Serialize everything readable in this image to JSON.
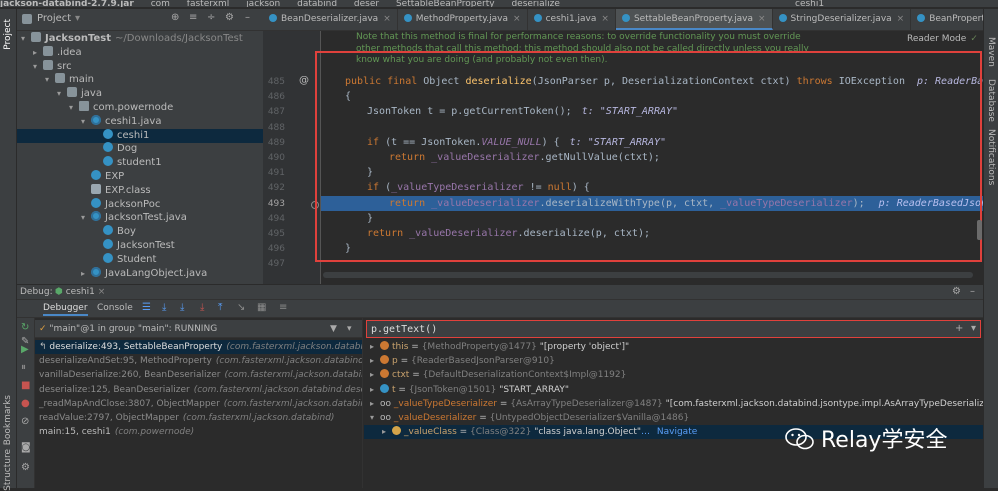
{
  "titlebar": {
    "items": [
      "jackson-databind-2.7.9.jar",
      "com",
      "fasterxml",
      "jackson",
      "databind",
      "deser",
      "SettableBeanProperty",
      "deserialize"
    ],
    "run_config": "ceshi1"
  },
  "left_strip": {
    "project": "Project",
    "bookmarks": "Bookmarks",
    "structure": "Structure"
  },
  "right_strip": {
    "maven": "Maven",
    "database": "Database",
    "notifications": "Notifications"
  },
  "project_panel": {
    "title": "Project"
  },
  "tree": [
    {
      "label": "JacksonTest",
      "extra": "~/Downloads/JacksonTest",
      "icon": "folder",
      "depth": 0,
      "arrow": "▾"
    },
    {
      "label": ".idea",
      "icon": "folder",
      "depth": 1,
      "arrow": "▸"
    },
    {
      "label": "src",
      "icon": "folder",
      "depth": 1,
      "arrow": "▾"
    },
    {
      "label": "main",
      "icon": "folder",
      "depth": 2,
      "arrow": "▾"
    },
    {
      "label": "java",
      "icon": "folder",
      "depth": 3,
      "arrow": "▾"
    },
    {
      "label": "com.powernode",
      "icon": "pkg",
      "depth": 4,
      "arrow": "▾"
    },
    {
      "label": "ceshi1.java",
      "icon": "java",
      "depth": 5,
      "arrow": "▾"
    },
    {
      "label": "ceshi1",
      "icon": "cls",
      "depth": 6,
      "arrow": "",
      "selected": true
    },
    {
      "label": "Dog",
      "icon": "cls",
      "depth": 6,
      "arrow": ""
    },
    {
      "label": "student1",
      "icon": "cls",
      "depth": 6,
      "arrow": ""
    },
    {
      "label": "EXP",
      "icon": "cls",
      "depth": 5,
      "arrow": ""
    },
    {
      "label": "EXP.class",
      "icon": "file",
      "depth": 5,
      "arrow": ""
    },
    {
      "label": "JacksonPoc",
      "icon": "cls",
      "depth": 5,
      "arrow": ""
    },
    {
      "label": "JacksonTest.java",
      "icon": "java",
      "depth": 5,
      "arrow": "▾"
    },
    {
      "label": "Boy",
      "icon": "cls",
      "depth": 6,
      "arrow": ""
    },
    {
      "label": "JacksonTest",
      "icon": "cls",
      "depth": 6,
      "arrow": ""
    },
    {
      "label": "Student",
      "icon": "cls",
      "depth": 6,
      "arrow": ""
    },
    {
      "label": "JavaLangObject.java",
      "icon": "java",
      "depth": 5,
      "arrow": "▸"
    }
  ],
  "tabs": [
    {
      "label": "BeanDeserializer.java",
      "active": false
    },
    {
      "label": "MethodProperty.java",
      "active": false
    },
    {
      "label": "ceshi1.java",
      "active": false
    },
    {
      "label": "SettableBeanProperty.java",
      "active": true
    },
    {
      "label": "StringDeserializer.java",
      "active": false
    },
    {
      "label": "BeanPropertyMap.java",
      "active": false
    }
  ],
  "reader_mode": "Reader Mode",
  "doc_comment": [
    "Note that this method is final for performance reasons: to override functionality you must override",
    "other methods that call this method; this method should also not be called directly unless you really",
    "know what you are doing (and probably not even then)."
  ],
  "line_numbers": [
    "485",
    "486",
    "487",
    "488",
    "489",
    "490",
    "491",
    "492",
    "493",
    "494",
    "495",
    "496",
    "497"
  ],
  "code": {
    "l485": {
      "kw1": "public final ",
      "type": "Object ",
      "fn": "deserialize",
      "rest": "(JsonParser p, DeserializationContext ctxt) ",
      "kw2": "throws ",
      "exc": "IOException",
      "hint": "p: ReaderBasedJsonPa"
    },
    "l487": {
      "text": "JsonToken t = p.getCurrentToken();",
      "hint": "t: \"START_ARRAY\""
    },
    "l489": {
      "kw": "if ",
      "pre": "(t == JsonToken.",
      "fld": "VALUE_NULL",
      "post": ") {",
      "hint": "t: \"START_ARRAY\""
    },
    "l490": {
      "kw": "return ",
      "fld": "_valueDeserializer",
      "post": ".getNullValue(ctxt);"
    },
    "l491": {
      "text": "}"
    },
    "l492": {
      "kw": "if ",
      "pre": "(",
      "fld": "_valueTypeDeserializer",
      "mid": " != ",
      "kw2": "null",
      "post": ") {"
    },
    "l493": {
      "kw": "return ",
      "fld": "_valueDeserializer",
      "mid": ".deserializeWithType(p, ctxt, ",
      "fld2": "_valueTypeDeserializer",
      "post": ");",
      "hint": "p: ReaderBasedJsonParser@9"
    },
    "l494": {
      "text": "}"
    },
    "l495": {
      "kw": "return ",
      "fld": "_valueDeserializer",
      "post": ".deserialize(p, ctxt);"
    },
    "l496": {
      "text": "}"
    }
  },
  "debug": {
    "label": "Debug:",
    "session": "ceshi1",
    "tab_debugger": "Debugger",
    "tab_console": "Console",
    "thread": "\"main\"@1 in group \"main\": RUNNING",
    "expression": "p.getText()"
  },
  "frames": [
    {
      "method": "deserialize:493, SettableBeanProperty",
      "pkg": "(com.fasterxml.jackson.databind.d",
      "selected": true
    },
    {
      "method": "deserializeAndSet:95, MethodProperty",
      "pkg": "(com.fasterxml.jackson.databind.d",
      "selected": false
    },
    {
      "method": "vanillaDeserialize:260, BeanDeserializer",
      "pkg": "(com.fasterxml.jackson.databind.d",
      "selected": false
    },
    {
      "method": "deserialize:125, BeanDeserializer",
      "pkg": "(com.fasterxml.jackson.databind.deser)",
      "selected": false
    },
    {
      "method": "_readMapAndClose:3807, ObjectMapper",
      "pkg": "(com.fasterxml.jackson.databind)",
      "selected": false
    },
    {
      "method": "readValue:2797, ObjectMapper",
      "pkg": "(com.fasterxml.jackson.databind)",
      "selected": false
    },
    {
      "method": "main:15, ceshi1",
      "pkg": "(com.powernode)",
      "selected": false
    }
  ],
  "variables": [
    {
      "arrow": "▸",
      "badge": "#cc7832",
      "name": "this",
      "eq": " = ",
      "type": "{MethodProperty@1477} ",
      "val": "\"[property 'object']\"",
      "link": "",
      "indent": 0
    },
    {
      "arrow": "▸",
      "badge": "#cc7832",
      "name": "p",
      "eq": " = ",
      "type": "{ReaderBasedJsonParser@910}",
      "val": "",
      "link": "",
      "indent": 0
    },
    {
      "arrow": "▸",
      "badge": "#cc7832",
      "name": "ctxt",
      "eq": " = ",
      "type": "{DefaultDeserializationContext$Impl@1192}",
      "val": "",
      "link": "",
      "indent": 0
    },
    {
      "arrow": "▸",
      "badge": "#3592c4",
      "name": "t",
      "eq": " = ",
      "type": "{JsonToken@1501} ",
      "val": "\"START_ARRAY\"",
      "link": "",
      "indent": 0
    },
    {
      "arrow": "▸",
      "badge": "oo",
      "name": "_valueTypeDeserializer",
      "eq": " = ",
      "type": "{AsArrayTypeDeserializer@1487} ",
      "val": "\"[com.fasterxml.jackson.databind.jsontype.impl.AsArrayTypeDeserializer; b",
      "link": "View",
      "indent": 0
    },
    {
      "arrow": "▾",
      "badge": "oo",
      "name": "_valueDeserializer",
      "eq": " = ",
      "type": "{UntypedObjectDeserializer$Vanilla@1486}",
      "val": "",
      "link": "",
      "indent": 0
    },
    {
      "arrow": "▸",
      "badge": "#d4a44a",
      "name": "_valueClass",
      "eq": " = ",
      "type": "{Class@322} ",
      "val": "\"class java.lang.Object\"",
      "link": "Navigate",
      "indent": 1,
      "selected": true
    }
  ],
  "watermark": "Relay学安全"
}
